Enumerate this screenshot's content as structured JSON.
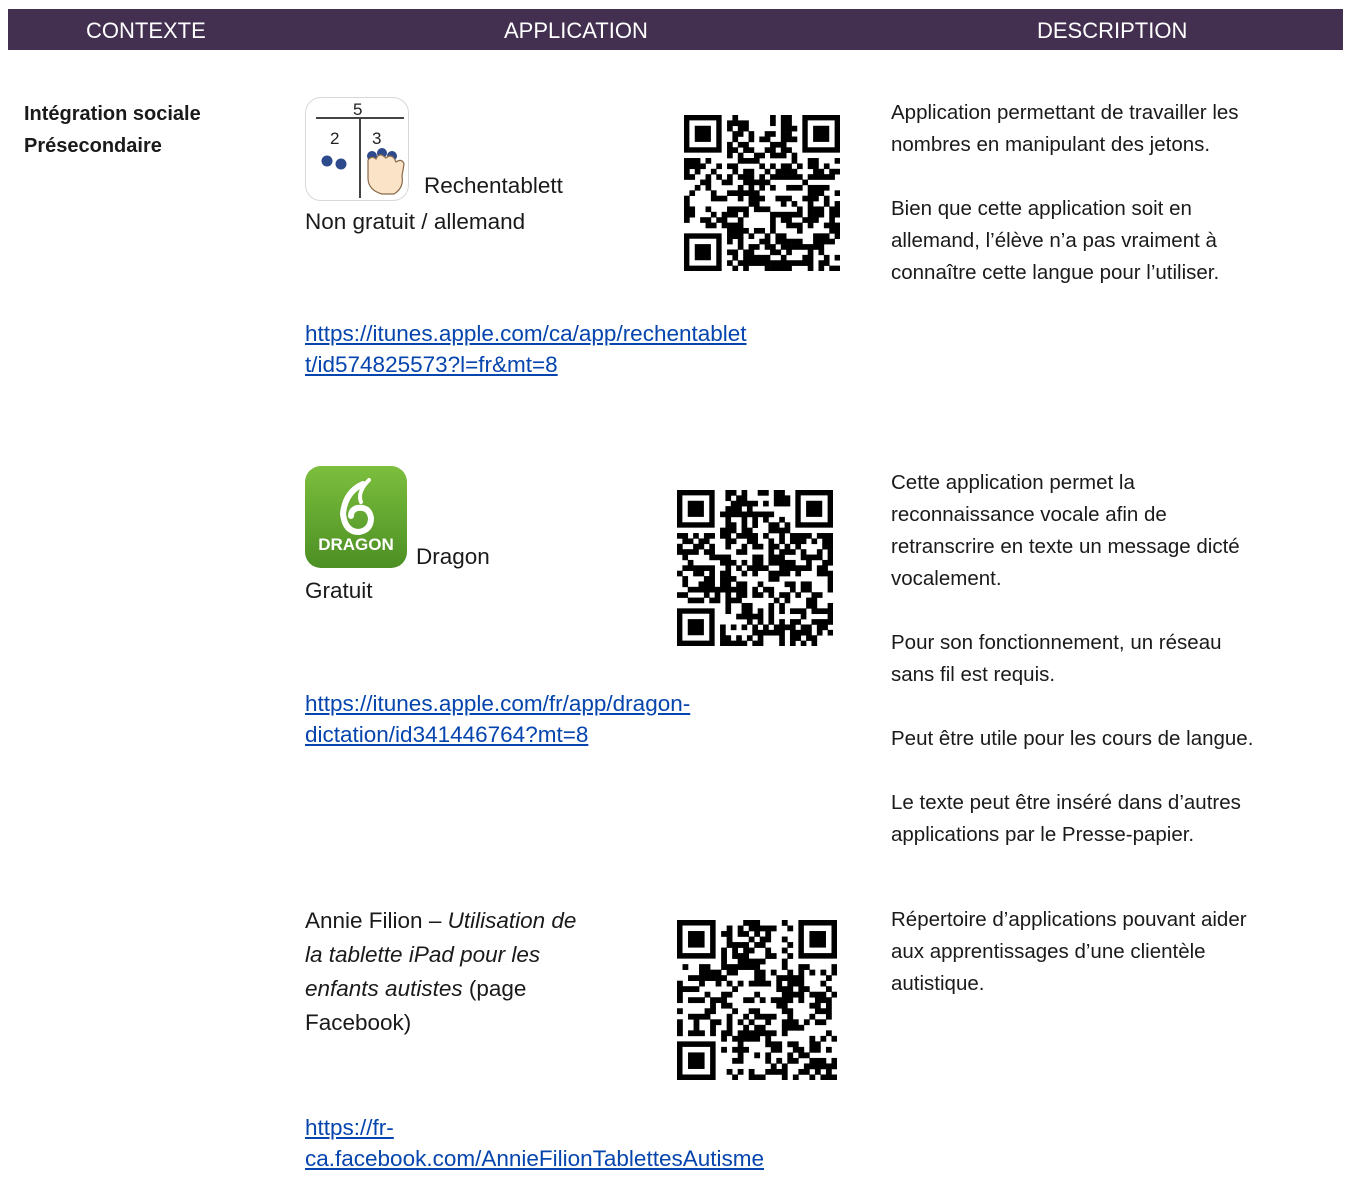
{
  "header": {
    "contexte": "CONTEXTE",
    "application": "APPLICATION",
    "description": "DESCRIPTION"
  },
  "context": {
    "line1": "Intégration sociale",
    "line2": "Présecondaire"
  },
  "apps": [
    {
      "icon_numbers": {
        "top": "5",
        "left": "2",
        "right": "3"
      },
      "name": "Rechentablett",
      "price_lang": "Non gratuit / allemand",
      "link_line1": "https://itunes.apple.com/ca/app/rechentablet",
      "link_line2": "t/id574825573?l=fr&mt=8",
      "desc_p1_line1": "Application permettant de travailler les",
      "desc_p1_line2": "nombres en manipulant des jetons.",
      "desc_p2_line1": "Bien que cette application soit en",
      "desc_p2_line2": "allemand, l’élève n’a pas vraiment à",
      "desc_p2_line3": "connaître cette langue pour l’utiliser.",
      "icon": "rechentablett-app-icon"
    },
    {
      "icon_word": "DRAGON",
      "name": "Dragon",
      "price": "Gratuit",
      "link_line1": "https://itunes.apple.com/fr/app/dragon-",
      "link_line2": "dictation/id341446764?mt=8",
      "desc_p1": [
        "Cette application permet la",
        "reconnaissance vocale afin de",
        "retranscrire en texte un message dicté",
        "vocalement."
      ],
      "desc_p2": [
        "Pour son fonctionnement, un réseau",
        "sans fil est requis."
      ],
      "desc_p3": "Peut être utile pour les cours de langue.",
      "desc_p4": [
        "Le texte peut être inséré dans d’autres",
        "applications par le Presse-papier."
      ],
      "icon": "dragon-app-icon"
    },
    {
      "author": "Annie Filion – ",
      "title_part1": "Utilisation de",
      "title_part2": "la tablette iPad pour les",
      "title_part3": "enfants autistes",
      "suffix1": " (page",
      "suffix2": "Facebook)",
      "link_line1": "https://fr-",
      "link_line2": "ca.facebook.com/AnnieFilionTablettesAutisme",
      "desc": [
        "Répertoire d’applications pouvant aider",
        "aux apprentissages d’une clientèle",
        "autistique."
      ]
    }
  ],
  "colors": {
    "header_bg": "#433050",
    "link": "#0645ad",
    "dragon_green": "#5aa02c"
  }
}
